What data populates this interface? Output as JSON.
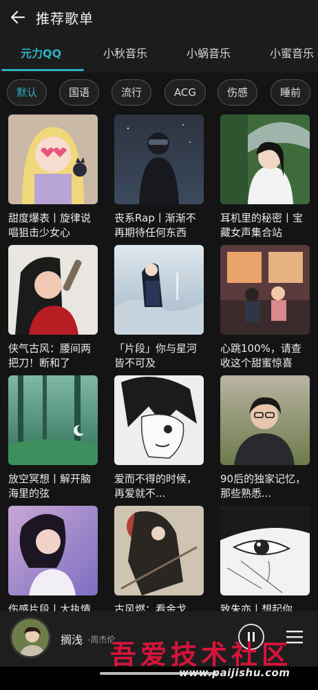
{
  "header": {
    "title": "推荐歌单"
  },
  "tabs": [
    {
      "label": "元力QQ",
      "active": true
    },
    {
      "label": "小秋音乐",
      "active": false
    },
    {
      "label": "小蜗音乐",
      "active": false
    },
    {
      "label": "小蜜音乐",
      "active": false
    }
  ],
  "chips": [
    {
      "label": "默认",
      "active": true
    },
    {
      "label": "国语",
      "active": false
    },
    {
      "label": "流行",
      "active": false
    },
    {
      "label": "ACG",
      "active": false
    },
    {
      "label": "伤感",
      "active": false
    },
    {
      "label": "睡前",
      "active": false
    }
  ],
  "playlists": [
    {
      "title": "甜度爆表丨旋律说唱狙击少女心"
    },
    {
      "title": "丧系Rap丨渐渐不再期待任何东西"
    },
    {
      "title": "耳机里的秘密丨宝藏女声集合站"
    },
    {
      "title": "侠气古风：腰间两把刀！断和了"
    },
    {
      "title": "「片段」你与星河皆不可及"
    },
    {
      "title": "心跳100%，请查收这个甜蜜惊喜"
    },
    {
      "title": "放空冥想丨解开脑海里的弦"
    },
    {
      "title": "爱而不得的时候，再爱就不..."
    },
    {
      "title": "90后的独家记忆，那些熟悉..."
    },
    {
      "title": "伤感片段丨太执情"
    },
    {
      "title": "古风燃：看金戈"
    },
    {
      "title": "致朱亦丨想起你"
    }
  ],
  "player": {
    "song": "搁浅",
    "artist": "-周杰伦"
  },
  "watermark": {
    "text": "吾爱技术社区",
    "url": "www.paijishu.com"
  },
  "colors": {
    "accent": "#2fb0c2",
    "background": "#141414",
    "watermark": "#d6143b"
  }
}
